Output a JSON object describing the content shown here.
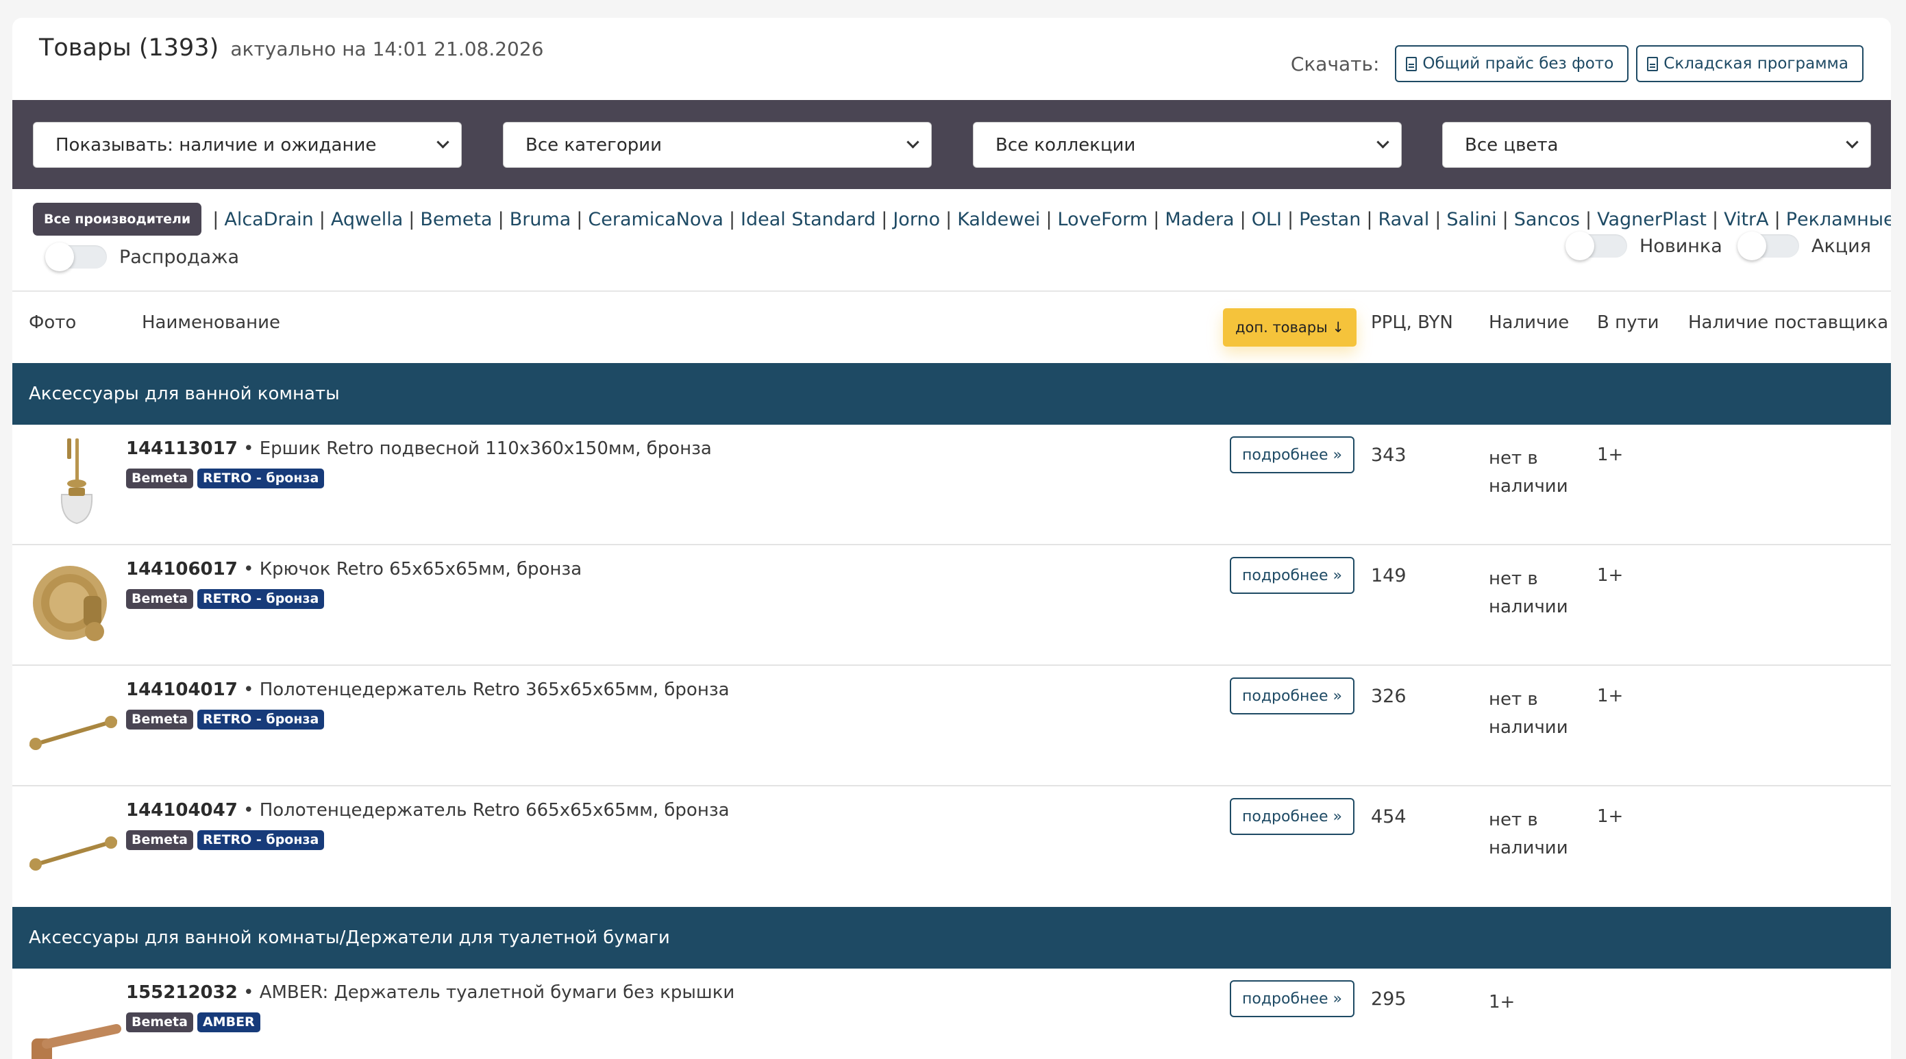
{
  "header": {
    "title": "Товары (1393)",
    "subtitle": "актуально на 14:01 21.08.2026",
    "download_label": "Скачать:",
    "buttons": [
      {
        "label": "Общий прайс без фото",
        "icon": "document-icon"
      },
      {
        "label": "Складская программа",
        "icon": "document-icon"
      }
    ]
  },
  "filters": {
    "show": "Показывать: наличие и ожидание",
    "category": "Все категории",
    "collection": "Все коллекции",
    "color": "Все цвета"
  },
  "manufacturers": {
    "all_label": "Все производители",
    "brands": [
      "AlcaDrain",
      "Aqwella",
      "Bemeta",
      "Bruma",
      "CeramicaNova",
      "Ideal Standard",
      "Jorno",
      "Kaldewei",
      "LoveForm",
      "Madera",
      "OLI",
      "Pestan",
      "Raval",
      "Salini",
      "Sancos",
      "VagnerPlast",
      "VitrA",
      "Рекламные материалы"
    ],
    "separator": "|",
    "toggles": {
      "sale": "Распродажа",
      "new": "Новинка",
      "promo": "Акция"
    }
  },
  "table": {
    "columns": {
      "photo": "Фото",
      "name": "Наименование",
      "extra": "доп. товары ↓",
      "price": "РРЦ, BYN",
      "stock": "Наличие",
      "transit": "В пути",
      "supplier": "Наличие поставщика"
    }
  },
  "groups": [
    {
      "title": "Аксессуары для ванной комнаты",
      "items": [
        {
          "code": "144113017",
          "name": " • Ершик Retro подвесной 110х360х150мм, бронза",
          "brand": "Bemeta",
          "collection": "RETRO - бронза",
          "more": "подробнее »",
          "price": "343",
          "stock": "нет в наличии",
          "transit": "1+",
          "image": "toilet-brush"
        },
        {
          "code": "144106017",
          "name": " • Крючок Retro 65х65х65мм, бронза",
          "brand": "Bemeta",
          "collection": "RETRO - бронза",
          "more": "подробнее »",
          "price": "149",
          "stock": "нет в наличии",
          "transit": "1+",
          "image": "hook"
        },
        {
          "code": "144104017",
          "name": " • Полотенцедержатель Retro 365х65х65мм, бронза",
          "brand": "Bemeta",
          "collection": "RETRO - бронза",
          "more": "подробнее »",
          "price": "326",
          "stock": "нет в наличии",
          "transit": "1+",
          "image": "towel-bar"
        },
        {
          "code": "144104047",
          "name": " • Полотенцедержатель Retro 665х65х65мм, бронза",
          "brand": "Bemeta",
          "collection": "RETRO - бронза",
          "more": "подробнее »",
          "price": "454",
          "stock": "нет в наличии",
          "transit": "1+",
          "image": "towel-bar"
        }
      ]
    },
    {
      "title": "Аксессуары для ванной комнаты/Держатели для туалетной бумаги",
      "items": [
        {
          "code": "155212032",
          "name": " • AMBER: Держатель туалетной бумаги без крышки",
          "brand": "Bemeta",
          "collection": "AMBER",
          "more": "подробнее »",
          "price": "295",
          "stock": "1+",
          "transit": "",
          "image": "paper-holder"
        }
      ]
    }
  ]
}
